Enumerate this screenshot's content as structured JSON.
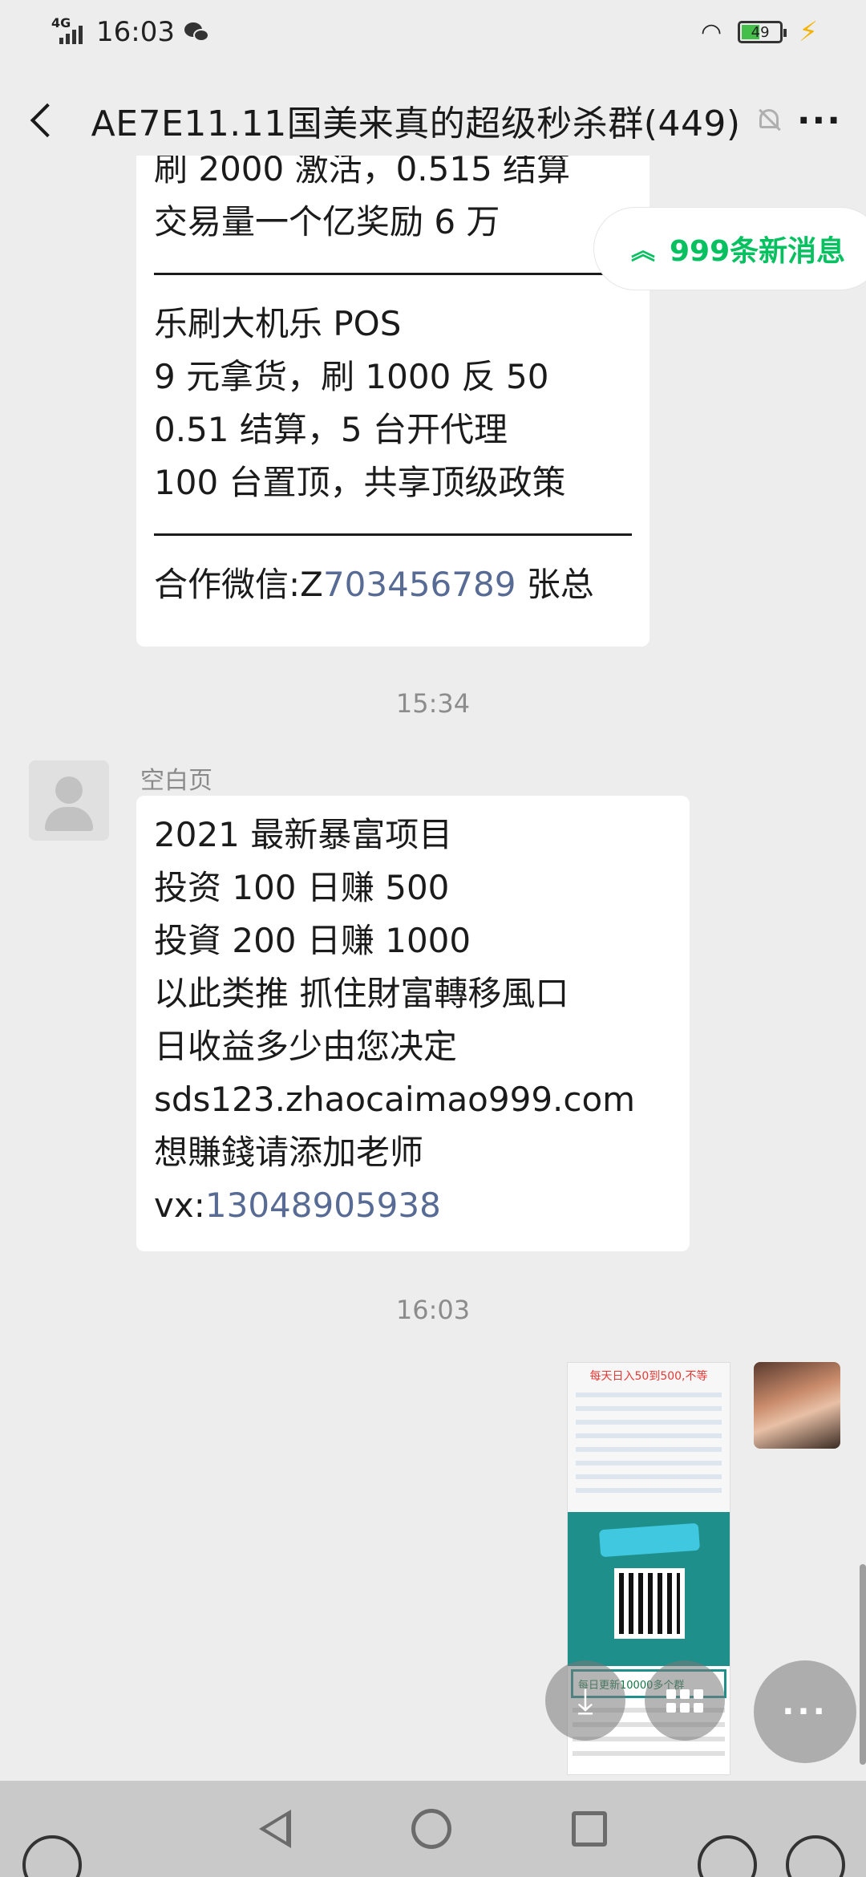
{
  "status_bar": {
    "network": "4G",
    "time": "16:03",
    "battery": "49"
  },
  "header": {
    "title": "AE7E11.11国美来真的超级秒杀群(449)"
  },
  "new_messages_pill": "999条新消息",
  "message1": {
    "lines_a": [
      "刷 2000 激活，0.515 结算",
      "交易量一个亿奖励 6 万"
    ],
    "lines_b": [
      "乐刷大机乐 POS",
      "9 元拿货，刷 1000 反 50",
      "0.51 结算，5 台开代理",
      "100 台置顶，共享顶级政策"
    ],
    "contact_prefix": "合作微信:Z",
    "contact_number": "703456789",
    "contact_suffix": " 张总"
  },
  "timestamp1": "15:34",
  "message2": {
    "sender": "空白页",
    "lines": [
      "2021 最新暴富项目",
      "投资 100 日赚 500",
      "投資 200 日赚 1000",
      "以此类推  抓住財富轉移風口",
      "日收益多少由您决定",
      "sds123.zhaocaimao999.com",
      "想賺錢请添加老师"
    ],
    "contact_prefix": "vx:",
    "contact_number": "13048905938"
  },
  "timestamp2": "16:03",
  "image_message": {
    "banner": "每天日入50到500,不等",
    "bar_text": "每日更新10000多个群"
  }
}
